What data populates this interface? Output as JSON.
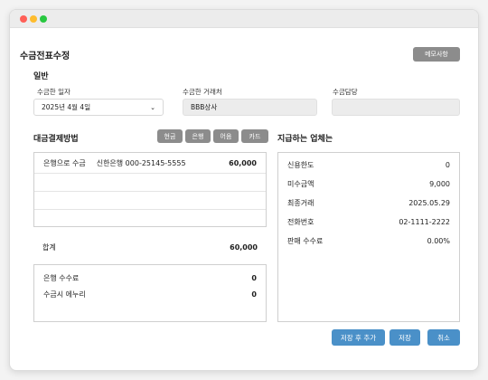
{
  "window": {
    "title": "수금전표수정",
    "memo_button": "메모사항"
  },
  "general": {
    "section_label": "일반",
    "date_label": "수금한 일자",
    "date_value": "2025년 4월 4일",
    "vendor_label": "수금한 거래처",
    "vendor_value": "BBB상사",
    "manager_label": "수금담당",
    "manager_value": ""
  },
  "payment": {
    "section_label": "대금결제방법",
    "method_buttons": [
      "현금",
      "은행",
      "어음",
      "카드"
    ],
    "rows": [
      {
        "method": "은행으로 수금",
        "detail": "신한은행 000-25145-5555",
        "amount": "60,000"
      }
    ],
    "total_label": "합계",
    "total_value": "60,000",
    "fees": [
      {
        "label": "은행 수수료",
        "value": "0"
      },
      {
        "label": "수금시 에누리",
        "value": "0"
      }
    ]
  },
  "vendor_info": {
    "section_label": "지급하는 업체는",
    "rows": [
      {
        "label": "신용한도",
        "value": "0"
      },
      {
        "label": "미수금액",
        "value": "9,000"
      },
      {
        "label": "최종거래",
        "value": "2025.05.29"
      },
      {
        "label": "전화번호",
        "value": "02-1111-2222"
      },
      {
        "label": "판매 수수료",
        "value": "0.00%"
      }
    ]
  },
  "footer": {
    "save_and_add": "저장 후 추가",
    "save": "저장",
    "cancel": "취소"
  },
  "colors": {
    "accent": "#4a90c8",
    "gray_button": "#8c8c8c"
  }
}
